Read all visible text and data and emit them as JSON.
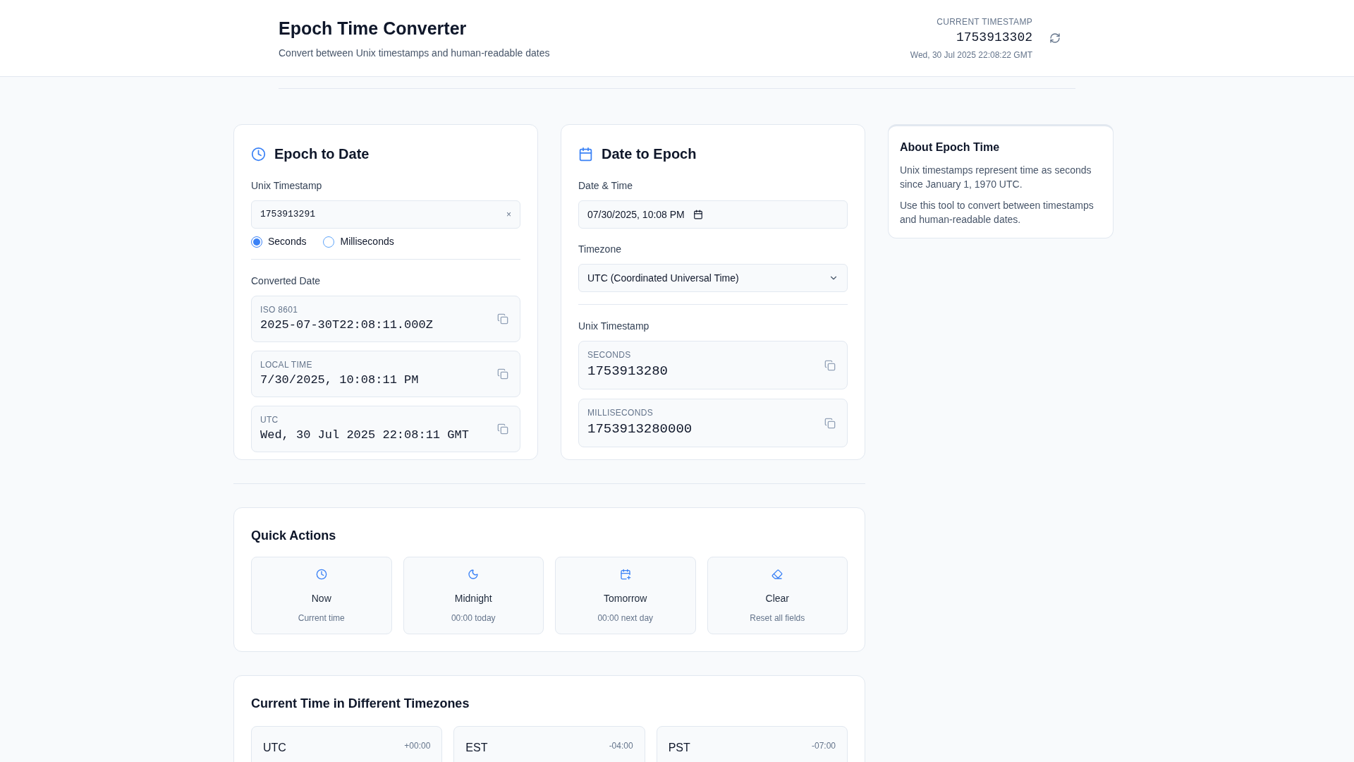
{
  "header": {
    "title": "Epoch Time Converter",
    "subtitle": "Convert between Unix timestamps and human-readable dates",
    "current_label": "CURRENT TIMESTAMP",
    "current_value": "1753913302",
    "current_date": "Wed, 30 Jul 2025 22:08:22 GMT"
  },
  "epoch_to_date": {
    "title": "Epoch to Date",
    "field_label": "Unix Timestamp",
    "value": "1753913291",
    "clear": "×",
    "units": [
      {
        "label": "Seconds",
        "selected": true
      },
      {
        "label": "Milliseconds",
        "selected": false
      }
    ],
    "result_label": "Converted Date",
    "results": [
      {
        "label": "ISO 8601",
        "value": "2025-07-30T22:08:11.000Z"
      },
      {
        "label": "LOCAL TIME",
        "value": "7/30/2025, 10:08:11 PM"
      },
      {
        "label": "UTC",
        "value": "Wed, 30 Jul 2025 22:08:11 GMT"
      }
    ]
  },
  "date_to_epoch": {
    "title": "Date to Epoch",
    "date_label": "Date & Time",
    "date_value": "07/30/2025, 10:08 PM",
    "timezone_label": "Timezone",
    "timezone_value": "UTC (Coordinated Universal Time)",
    "result_label": "Unix Timestamp",
    "results": [
      {
        "label": "SECONDS",
        "value": "1753913280"
      },
      {
        "label": "MILLISECONDS",
        "value": "1753913280000"
      }
    ]
  },
  "about": {
    "title": "About Epoch Time",
    "paragraphs": [
      "Unix timestamps represent time as seconds since January 1, 1970 UTC.",
      "Use this tool to convert between timestamps and human-readable dates."
    ]
  },
  "quick_actions": {
    "title": "Quick Actions",
    "items": [
      {
        "kind": "clock",
        "label": "Now",
        "hint": "Current time"
      },
      {
        "kind": "moon",
        "label": "Midnight",
        "hint": "00:00 today"
      },
      {
        "kind": "calendar",
        "label": "Tomorrow",
        "hint": "00:00 next day"
      },
      {
        "kind": "eraser",
        "label": "Clear",
        "hint": "Reset all fields"
      }
    ]
  },
  "timezones": {
    "title": "Current Time in Different Timezones",
    "items": [
      {
        "name": "UTC",
        "offset": "+00:00"
      },
      {
        "name": "EST",
        "offset": "-04:00"
      },
      {
        "name": "PST",
        "offset": "-07:00"
      }
    ]
  }
}
